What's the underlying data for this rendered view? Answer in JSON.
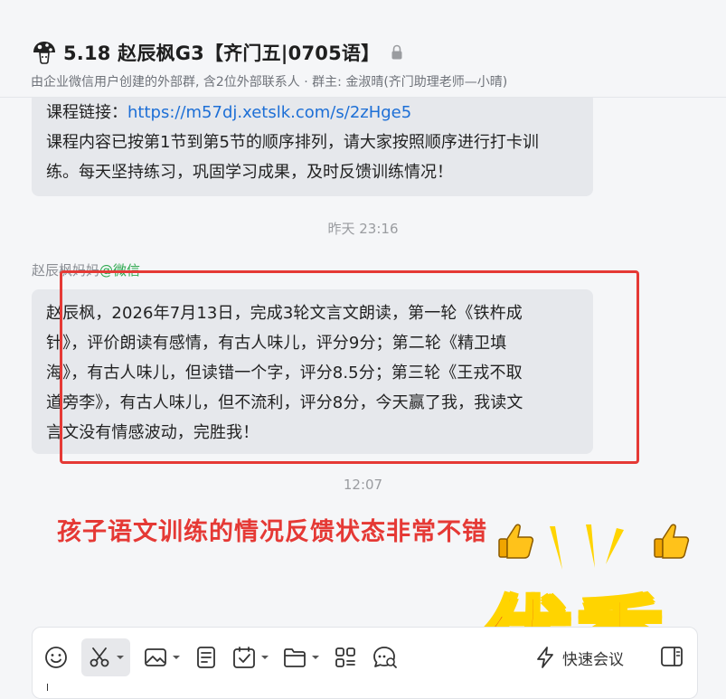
{
  "header": {
    "title": "5.18 赵辰枫G3【齐门五|0705语】",
    "subtitle": "由企业微信用户创建的外部群, 含2位外部联系人 · 群主: 金淑晴(齐门助理老师—小晴)"
  },
  "messages": {
    "msg1": {
      "line1_prefix": "课程链接：",
      "line1_link": "https://m57dj.xetslk.com/s/2zHge5",
      "line2": "课程内容已按第1节到第5节的顺序排列，请大家按照顺序进行打卡训",
      "line3": "练。每天坚持练习，巩固学习成果，及时反馈训练情况！"
    },
    "time1": "昨天 23:16",
    "sender": {
      "name": "赵辰枫妈妈",
      "platform": "@微信"
    },
    "msg2": {
      "lines": [
        "赵辰枫，2026年7月13日，完成3轮文言文朗读，第一轮《铁杵成",
        "针》，评价朗读有感情，有古人味儿，评分9分；第二轮《精卫填",
        "海》，有古人味儿，但读错一个字，评分8.5分；第三轮《王戎不取",
        "道旁李》，有古人味儿，但不流利，评分8分，今天赢了我，我读文",
        "言文没有情感波动，完胜我！"
      ]
    },
    "time2": "12:07"
  },
  "overlay": {
    "caption": "孩子语文训练的情况反馈状态非常不错",
    "big_text": "优秀",
    "highlight_color": "#e53935"
  },
  "composer": {
    "tools": [
      "emoji-icon",
      "scissors-icon",
      "image-icon",
      "document-icon",
      "schedule-icon",
      "folder-icon",
      "apps-icon",
      "chat-bubble-icon"
    ],
    "quick_meeting_label": "快速会议"
  }
}
